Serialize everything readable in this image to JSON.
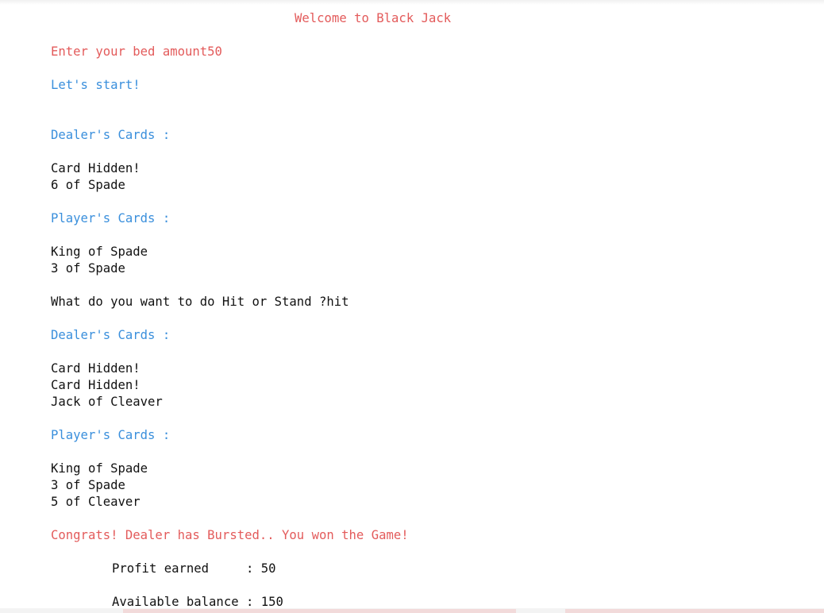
{
  "title": "Welcome to Black Jack",
  "bet_prompt": "Enter your bed amount50",
  "start_msg": "Let's start!",
  "round1": {
    "dealer_header": "Dealer's Cards :",
    "dealer_cards": [
      "Card Hidden!",
      "6 of Spade"
    ],
    "player_header": "Player's Cards :",
    "player_cards": [
      "King of Spade",
      "3 of Spade"
    ]
  },
  "action_prompt": "What do you want to do Hit or Stand ?hit",
  "round2": {
    "dealer_header": "Dealer's Cards :",
    "dealer_cards": [
      "Card Hidden!",
      "Card Hidden!",
      "Jack of Cleaver"
    ],
    "player_header": "Player's Cards :",
    "player_cards": [
      "King of Spade",
      "3 of Spade",
      "5 of Cleaver"
    ]
  },
  "result_msg": "Congrats! Dealer has Bursted.. You won the Game!",
  "summary": {
    "profit": "Profit earned     : 50",
    "balance": "Available balance : 150"
  },
  "colors": {
    "red": "#e35b5b",
    "blue": "#3a8fdc",
    "text": "#111111"
  }
}
